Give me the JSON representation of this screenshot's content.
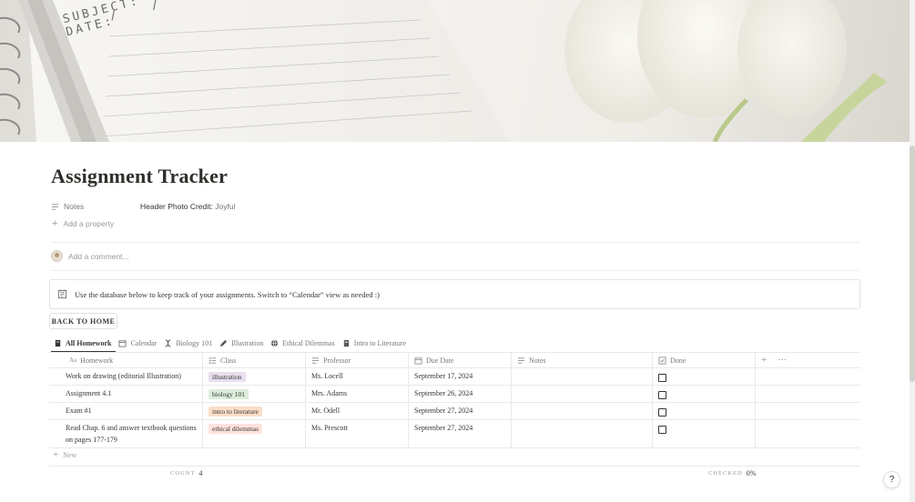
{
  "page": {
    "title": "Assignment Tracker",
    "cover_text_1": "SUBJECT:",
    "cover_text_2": "DATE:",
    "cover_text_3": "/     /"
  },
  "properties": {
    "notes_label": "Notes",
    "notes_value_prefix": "Header Photo Credit:",
    "notes_value_name": "Joyful",
    "add_property_label": "Add a property"
  },
  "comment": {
    "placeholder": "Add a comment..."
  },
  "callout": {
    "icon": "notepad-icon",
    "text": "Use the database below to keep track of your assignments. Switch to “Calendar” view as needed :)"
  },
  "back_button": {
    "label": "BACK TO HOME"
  },
  "views": [
    {
      "label": "All Homework",
      "icon": "note-icon",
      "active": true
    },
    {
      "label": "Calendar",
      "icon": "calendar-icon",
      "active": false
    },
    {
      "label": "Biology 101",
      "icon": "dna-icon",
      "active": false
    },
    {
      "label": "Illustration",
      "icon": "pencil-icon",
      "active": false
    },
    {
      "label": "Ethical Dilemmas",
      "icon": "globe-icon",
      "active": false
    },
    {
      "label": "Intro to Literature",
      "icon": "book-icon",
      "active": false
    }
  ],
  "table": {
    "columns": [
      "Homework",
      "Class",
      "Professor",
      "Due Date",
      "Notes",
      "Done"
    ],
    "rows": [
      {
        "homework": "Work on drawing (editorial Illustration)",
        "class": "illustration",
        "class_color": "#e8deee",
        "professor": "Ms. Locell",
        "due": "September 17, 2024",
        "notes": "",
        "done": false
      },
      {
        "homework": "Assignment 4.1",
        "class": "biology 101",
        "class_color": "#dbeddb",
        "professor": "Mrs. Adams",
        "due": "September 26, 2024",
        "notes": "",
        "done": false
      },
      {
        "homework": "Exam #1",
        "class": "intro to literature",
        "class_color": "#fadec9",
        "professor": "Mr. Odell",
        "due": "September 27, 2024",
        "notes": "",
        "done": false
      },
      {
        "homework": "Read Chap. 6 and answer textbook questions on pages 177-179",
        "class": "ethical dilemmas",
        "class_color": "#ffe2dd",
        "professor": "Ms. Prescott",
        "due": "September 27, 2024",
        "notes": "",
        "done": false
      }
    ],
    "new_label": "New",
    "count_label": "COUNT",
    "count_value": "4",
    "checked_label": "CHECKED",
    "checked_value": "0%"
  },
  "help": {
    "label": "?"
  }
}
